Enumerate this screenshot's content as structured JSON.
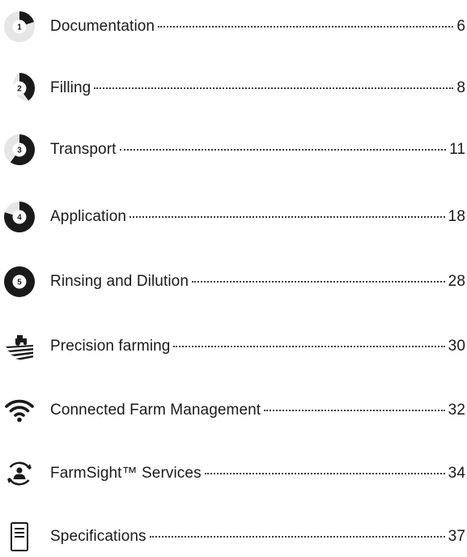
{
  "toc": {
    "items": [
      {
        "title": "Documentation",
        "page": "6",
        "icon": "step-1-icon",
        "step": "1"
      },
      {
        "title": "Filling",
        "page": "8",
        "icon": "step-2-icon",
        "step": "2"
      },
      {
        "title": "Transport",
        "page": "11",
        "icon": "step-3-icon",
        "step": "3"
      },
      {
        "title": "Application",
        "page": "18",
        "icon": "step-4-icon",
        "step": "4"
      },
      {
        "title": "Rinsing and Dilution",
        "page": "28",
        "icon": "step-5-icon",
        "step": "5"
      },
      {
        "title": "Precision farming",
        "page": "30",
        "icon": "tractor-field-icon"
      },
      {
        "title": "Connected Farm Management",
        "page": "32",
        "icon": "wifi-icon"
      },
      {
        "title": "FarmSight™ Services",
        "page": "34",
        "icon": "person-cycle-icon"
      },
      {
        "title": "Specifications",
        "page": "37",
        "icon": "document-icon"
      }
    ]
  },
  "colors": {
    "dark": "#1a1a1a",
    "light_segment": "#e6e6e6"
  }
}
